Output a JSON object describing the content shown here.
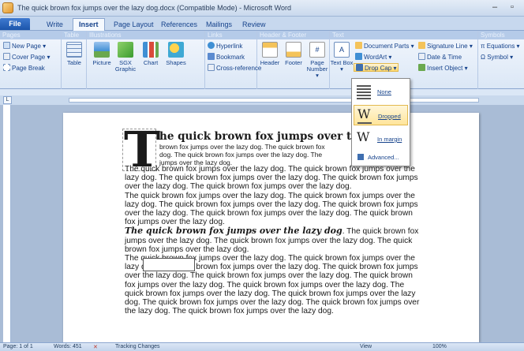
{
  "window": {
    "title": "The quick brown fox jumps over the lazy dog.docx (Compatible Mode) - Microsoft Word",
    "minimize": "–",
    "restore": "▫"
  },
  "tabs": [
    "File",
    "Write",
    "Insert",
    "Page Layout",
    "References",
    "Mailings",
    "Review"
  ],
  "ribbon": {
    "groups": {
      "pages": "Pages",
      "tables": "Table",
      "illustrations": "Illustrations",
      "links": "Links",
      "header_footer": "Header & Footer",
      "text": "Text",
      "symbols": "Symbols"
    },
    "pages_buttons": [
      "New Page ▾",
      "Cover Page ▾",
      "Page Break"
    ],
    "big_buttons": [
      "Table",
      "Picture",
      "SGX Graphic",
      "Chart",
      "Shapes"
    ],
    "links_buttons": [
      "Hyperlink",
      "Bookmark",
      "Cross-reference"
    ],
    "hf_buttons": [
      "Header",
      "Footer",
      "Page Number ▾"
    ],
    "text_big": "Text Box ▾",
    "text_buttons": [
      "Document Parts ▾",
      "WordArt ▾",
      "Drop Cap ▾"
    ],
    "text_right": [
      "Signature Line ▾",
      "Date & Time",
      "Insert Object ▾"
    ],
    "symbols_buttons": [
      "π Equations ▾",
      "Ω Symbol ▾"
    ]
  },
  "dropcap_menu": {
    "items": [
      "None",
      "Dropped",
      "In margin"
    ],
    "advanced": "Advanced..."
  },
  "document": {
    "dropcap_letter": "T",
    "heading": "he quick brown fox jumps over the laz",
    "heading_tail": "y",
    "small_lines": [
      "brown fox jumps over the lazy dog.  The quick brown fox",
      "dog.  The quick brown fox jumps over the lazy dog.  The",
      "jumps over the lazy dog."
    ],
    "para1": "The quick brown fox jumps over the lazy dog.  The quick brown fox jumps over the lazy dog.  The quick brown fox jumps over the lazy dog.  The quick brown fox jumps over the lazy dog.  The quick brown fox jumps over the lazy dog.",
    "para2": "The quick brown fox jumps over the lazy dog.  The quick brown fox jumps over the lazy dog.  The quick brown fox jumps over the lazy dog.  The quick brown fox jumps over the lazy dog.  The quick brown fox jumps over the lazy dog.  The quick brown fox jumps over the lazy dog.",
    "italic_heading": "The quick brown fox jumps over the lazy dog",
    "para3": ".  The quick brown fox jumps over the lazy dog.  The quick brown fox jumps over the lazy dog.  The quick brown fox jumps over the lazy dog.",
    "para4": "The quick brown fox jumps over the lazy dog.  The quick brown fox jumps over the lazy dog.  The quick brown fox jumps over the lazy dog.  The quick brown fox jumps over the lazy dog.  The quick brown fox jumps over the lazy dog.  The quick brown fox jumps over the lazy dog.  The quick brown fox jumps over the lazy dog.  The quick brown fox jumps over the lazy dog.  The quick brown fox jumps over the lazy dog.  The quick brown fox jumps over the lazy dog.  The quick brown fox jumps over the lazy dog.  The quick brown fox jumps over the lazy dog."
  },
  "status": {
    "page": "Page: 1 of 1",
    "words": "Words: 451",
    "track": "Tracking Changes",
    "view": "View",
    "zoom": "100%"
  },
  "colors": {
    "accent": "#15428b",
    "ribbon": "#dbe7f6",
    "hover": "#ffe59b"
  }
}
